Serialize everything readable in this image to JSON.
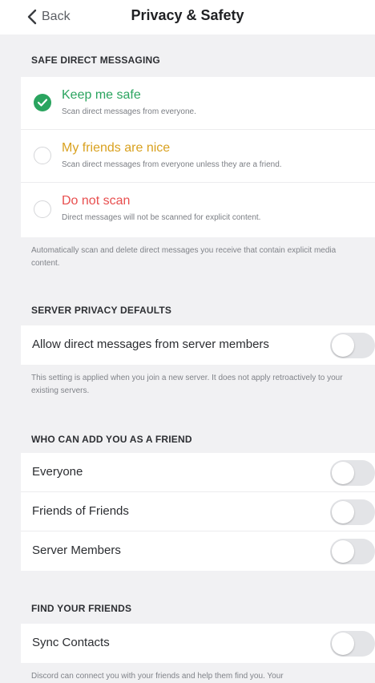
{
  "header": {
    "back_label": "Back",
    "title": "Privacy & Safety"
  },
  "safe_dm": {
    "section_title": "SAFE DIRECT MESSAGING",
    "options": [
      {
        "label": "Keep me safe",
        "description": "Scan direct messages from everyone.",
        "color": "#2aa45f",
        "selected": true
      },
      {
        "label": "My friends are nice",
        "description": "Scan direct messages from everyone unless they are a friend.",
        "color": "#d9a11f",
        "selected": false
      },
      {
        "label": "Do not scan",
        "description": "Direct messages will not be scanned for explicit content.",
        "color": "#e84f4f",
        "selected": false
      }
    ],
    "footer": "Automatically scan and delete direct messages you receive that contain explicit media content."
  },
  "server_privacy": {
    "section_title": "SERVER PRIVACY DEFAULTS",
    "toggle_label": "Allow direct messages from server members",
    "toggle_on": false,
    "footer": "This setting is applied when you join a new server. It does not apply retroactively to your existing servers."
  },
  "add_friend": {
    "section_title": "WHO CAN ADD YOU AS A FRIEND",
    "items": [
      {
        "label": "Everyone",
        "on": false
      },
      {
        "label": "Friends of Friends",
        "on": false
      },
      {
        "label": "Server Members",
        "on": false
      }
    ]
  },
  "find_friends": {
    "section_title": "FIND YOUR FRIENDS",
    "toggle_label": "Sync Contacts",
    "toggle_on": false,
    "footer": "Discord can connect you with your friends and help them find you. Your"
  }
}
